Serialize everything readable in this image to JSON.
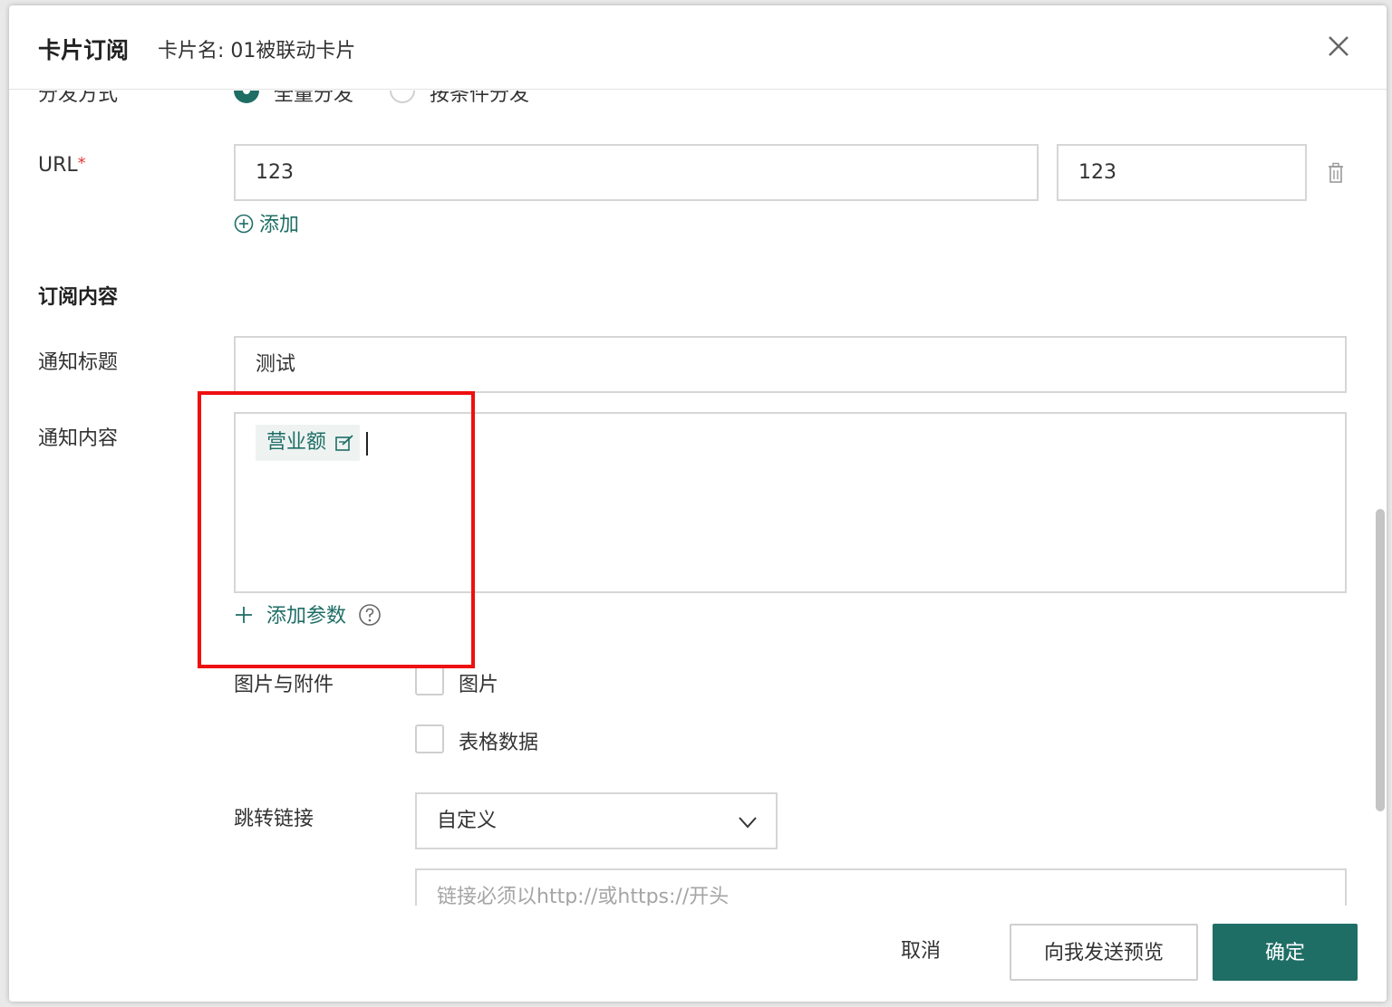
{
  "header": {
    "title": "卡片订阅",
    "subtitle": "卡片名: 01被联动卡片"
  },
  "distribution": {
    "label": "分发方式",
    "required_mark": "*",
    "options": [
      {
        "label": "全量分发",
        "checked": true
      },
      {
        "label": "按条件分发",
        "checked": false
      }
    ]
  },
  "url": {
    "label": "URL",
    "required_mark": "*",
    "value1": "123",
    "value2": "123",
    "add_label": "添加"
  },
  "subscription": {
    "section_title": "订阅内容",
    "notify_title_label": "通知标题",
    "notify_title_value": "测试",
    "notify_content_label": "通知内容",
    "content_tag": "营业额",
    "add_param_label": "添加参数",
    "attachments_label": "图片与附件",
    "attachment_options": [
      {
        "label": "图片",
        "checked": false
      },
      {
        "label": "表格数据",
        "checked": false
      }
    ],
    "jump_link_label": "跳转链接",
    "jump_link_value": "自定义",
    "link_placeholder": "链接必须以http://或https://开头"
  },
  "footer": {
    "cancel_label": "取消",
    "preview_label": "向我发送预览",
    "confirm_label": "确定"
  },
  "colors": {
    "accent": "#1f6e66",
    "required": "#e23a3a",
    "highlight": "#ee0f0f"
  }
}
